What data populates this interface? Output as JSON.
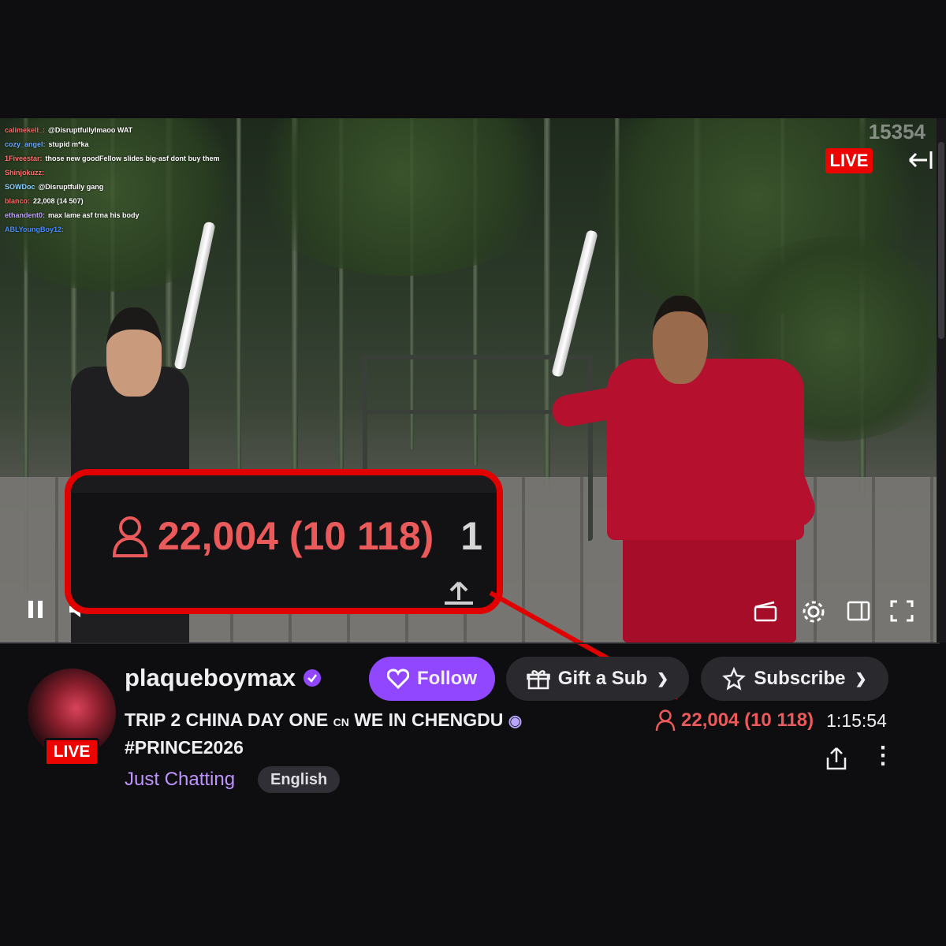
{
  "player": {
    "watermark": "15354",
    "live_label": "LIVE",
    "chat": [
      {
        "user": "calimekell_:",
        "text": "@DisruptfullyImaoo WAT",
        "color": "#ff6666"
      },
      {
        "user": "cozy_angel:",
        "text": "stupid m*ka",
        "color": "#6aa8ff"
      },
      {
        "user": "1Fiveestar:",
        "text": "those new goodFellow slides big-asf dont buy them",
        "color": "#ff7070"
      },
      {
        "user": "Shinjokuzz:",
        "text": "",
        "color": "#ff7070"
      },
      {
        "user": "SOWDoc",
        "text": "@Disruptfully gang",
        "color": "#8fd0ff"
      },
      {
        "user": "blanco:",
        "text": "22,008 (14 507)",
        "color": "#ff6666"
      },
      {
        "user": "ethandent0:",
        "text": "max lame asf trna his body",
        "color": "#c0a0ff"
      },
      {
        "user": "ABLYoungBoy12:",
        "text": "",
        "color": "#4b8dff"
      }
    ],
    "zoom": {
      "viewer_count": "22,004 (10 118)",
      "extra": "1",
      "person_icon": "person-icon",
      "share_icon": "share-icon"
    },
    "controls": {
      "pause_icon": "pause-icon",
      "volume_icon": "volume-icon",
      "clip_icon": "clip-icon",
      "settings_icon": "gear-icon",
      "theatre_icon": "theatre-mode-icon",
      "fullscreen_icon": "fullscreen-icon"
    }
  },
  "channel": {
    "name": "plaqueboymax",
    "live_label": "LIVE",
    "title_part1": "TRIP 2 CHINA DAY ONE",
    "title_flag": "CN",
    "title_part2": "WE IN CHENGDU",
    "title_line2": "#PRINCE2026",
    "category": "Just Chatting",
    "tag": "English",
    "viewer_count": "22,004 (10 118)",
    "uptime": "1:15:54"
  },
  "buttons": {
    "follow": "Follow",
    "gift": "Gift a Sub",
    "subscribe": "Subscribe"
  },
  "colors": {
    "accent": "#9147ff",
    "live": "#eb0400",
    "viewer": "#eb5a5a",
    "highlight": "#e00000"
  }
}
